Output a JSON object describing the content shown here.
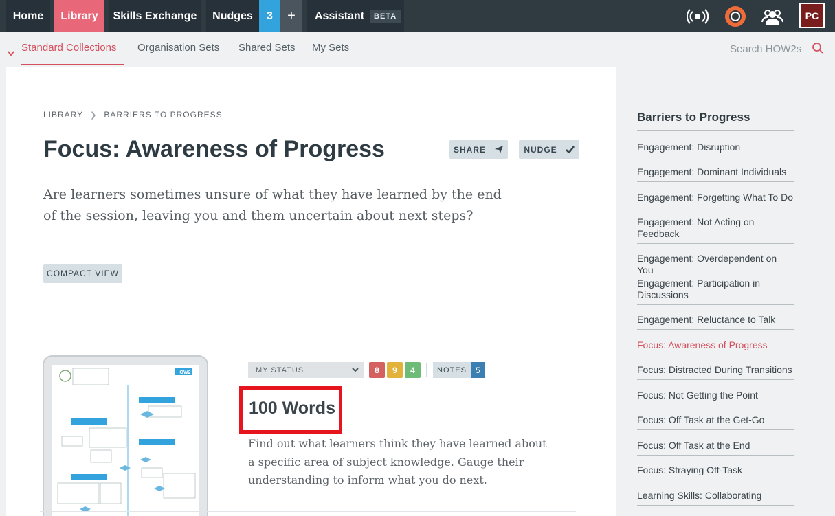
{
  "topnav": {
    "home": "Home",
    "library": "Library",
    "skills": "Skills Exchange",
    "nudges": "Nudges",
    "nudges_count": "3",
    "plus": "+",
    "assistant": "Assistant",
    "beta": "BETA",
    "avatar_initials": "PC"
  },
  "subnav": {
    "items": [
      "Standard Collections",
      "Organisation Sets",
      "Shared Sets",
      "My Sets"
    ],
    "search_placeholder": "Search HOW2s"
  },
  "breadcrumb": [
    "LIBRARY",
    "BARRIERS TO PROGRESS"
  ],
  "page": {
    "title": "Focus: Awareness of Progress",
    "share": "SHARE",
    "nudge": "NUDGE",
    "lead": "Are learners sometimes unsure of what they have learned by the end of the session, leaving you and them uncertain about next steps?",
    "compact_view": "COMPACT VIEW"
  },
  "card": {
    "my_status": "MY STATUS",
    "counts": [
      "8",
      "9",
      "4"
    ],
    "notes": "NOTES",
    "notes_count": "5",
    "title": "100 Words",
    "description": "Find out what learners think they have learned about a specific area of subject knowledge. Gauge their understanding to inform what you do next.",
    "thumb_badge": "HOW2"
  },
  "sidebar": {
    "title": "Barriers to Progress",
    "items": [
      "Engagement: Disruption",
      "Engagement: Dominant Individuals",
      "Engagement: Forgetting What To Do",
      "Engagement: Not Acting on Feedback",
      "Engagement: Overdependent on You",
      "Engagement: Participation in Discussions",
      "Engagement: Reluctance to Talk",
      "Focus: Awareness of Progress",
      "Focus: Distracted During Transitions",
      "Focus: Not Getting the Point",
      "Focus: Off Task at the Get-Go",
      "Focus: Off Task at the End",
      "Focus: Straying Off-Task",
      "Learning Skills: Collaborating"
    ]
  },
  "colors": {
    "accent": "#d4505f",
    "topbar": "#2f3a41",
    "library_tab": "#e8687a",
    "nudge_count": "#33a3dd",
    "highlight_box": "#e5141d"
  }
}
